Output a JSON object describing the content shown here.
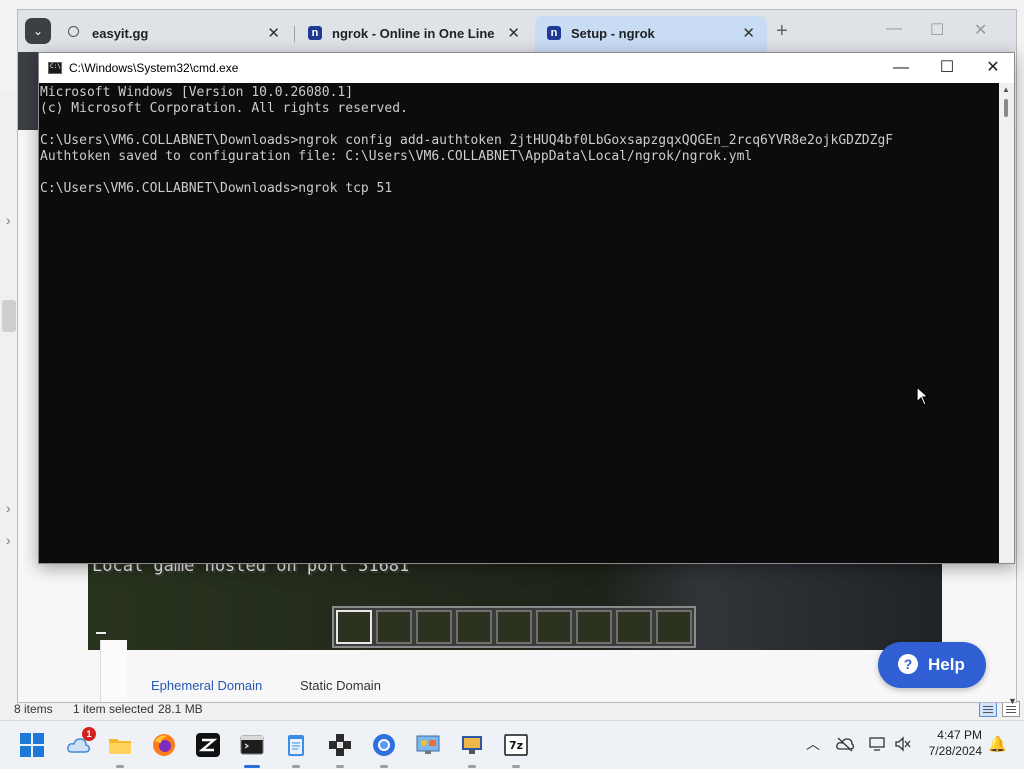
{
  "explorer": {
    "status": {
      "items": "8 items",
      "selected": "1 item selected",
      "size": "28.1 MB"
    }
  },
  "browser": {
    "tabs": [
      {
        "title": "easyit.gg",
        "favicon": "globe-icon"
      },
      {
        "title": "ngrok - Online in One Line",
        "favicon": "ngrok-icon"
      },
      {
        "title": "Setup - ngrok",
        "favicon": "ngrok-icon",
        "active": true
      }
    ],
    "page": {
      "game_message": "Local game hosted on port 51681",
      "domain_tabs": [
        "Ephemeral Domain",
        "Static Domain"
      ],
      "help_label": "Help"
    }
  },
  "cmd": {
    "title": "C:\\Windows\\System32\\cmd.exe",
    "console": "Microsoft Windows [Version 10.0.26080.1]\n(c) Microsoft Corporation. All rights reserved.\n\nC:\\Users\\VM6.COLLABNET\\Downloads>ngrok config add-authtoken 2jtHUQ4bf0LbGoxsapzgqxQQGEn_2rcq6YVR8e2ojkGDZDZgF\nAuthtoken saved to configuration file: C:\\Users\\VM6.COLLABNET\\AppData\\Local/ngrok/ngrok.yml\n\nC:\\Users\\VM6.COLLABNET\\Downloads>ngrok tcp 51"
  },
  "taskbar": {
    "apps": [
      "start",
      "weather",
      "file-explorer",
      "firefox",
      "zed",
      "terminal",
      "notepad",
      "minecraft",
      "chrome",
      "control-panel",
      "remote-desktop",
      "7zip"
    ],
    "weather_badge": "1",
    "clock": {
      "time": "4:47 PM",
      "date": "7/28/2024"
    }
  },
  "colors": {
    "accent": "#2f5fd3",
    "console_bg": "#0c0c0c",
    "console_fg": "#cccccc"
  }
}
